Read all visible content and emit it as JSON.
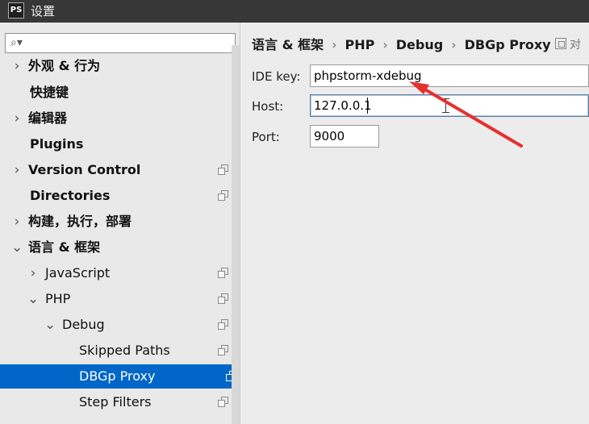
{
  "window": {
    "title": "设置",
    "logo_text": "PS"
  },
  "sidebar": {
    "search": {
      "value": "",
      "placeholder": ""
    },
    "items": [
      {
        "label": "外观 & 行为",
        "arrow": "›",
        "bold": true,
        "copy": false
      },
      {
        "label": "快捷键",
        "arrow": "",
        "bold": true,
        "copy": false
      },
      {
        "label": "编辑器",
        "arrow": "›",
        "bold": true,
        "copy": false
      },
      {
        "label": "Plugins",
        "arrow": "",
        "bold": true,
        "copy": false
      },
      {
        "label": "Version Control",
        "arrow": "›",
        "bold": true,
        "copy": true
      },
      {
        "label": "Directories",
        "arrow": "",
        "bold": true,
        "copy": true
      },
      {
        "label": "构建，执行，部署",
        "arrow": "›",
        "bold": true,
        "copy": false
      },
      {
        "label": "语言 & 框架",
        "arrow": "⌄",
        "bold": true,
        "copy": false
      },
      {
        "label": "JavaScript",
        "arrow": "›",
        "bold": false,
        "copy": true
      },
      {
        "label": "PHP",
        "arrow": "⌄",
        "bold": false,
        "copy": true
      },
      {
        "label": "Debug",
        "arrow": "⌄",
        "bold": false,
        "copy": true
      },
      {
        "label": "Skipped Paths",
        "arrow": "",
        "bold": false,
        "copy": true
      },
      {
        "label": "DBGp Proxy",
        "arrow": "",
        "bold": false,
        "copy": true,
        "selected": true
      },
      {
        "label": "Step Filters",
        "arrow": "",
        "bold": false,
        "copy": true
      }
    ]
  },
  "breadcrumb": {
    "items": [
      "语言 & 框架",
      "PHP",
      "Debug",
      "DBGp Proxy"
    ],
    "separator": "›",
    "project_label": "对"
  },
  "form": {
    "ide_key": {
      "label": "IDE key:",
      "value": "phpstorm-xdebug"
    },
    "host": {
      "label": "Host:",
      "value": "127.0.0.1"
    },
    "port": {
      "label": "Port:",
      "value": "9000"
    }
  },
  "annotation": {
    "arrow_color": "#e53030"
  },
  "colors": {
    "selection": "#0066c7",
    "title_bar": "#373737",
    "panel": "#ececec"
  }
}
